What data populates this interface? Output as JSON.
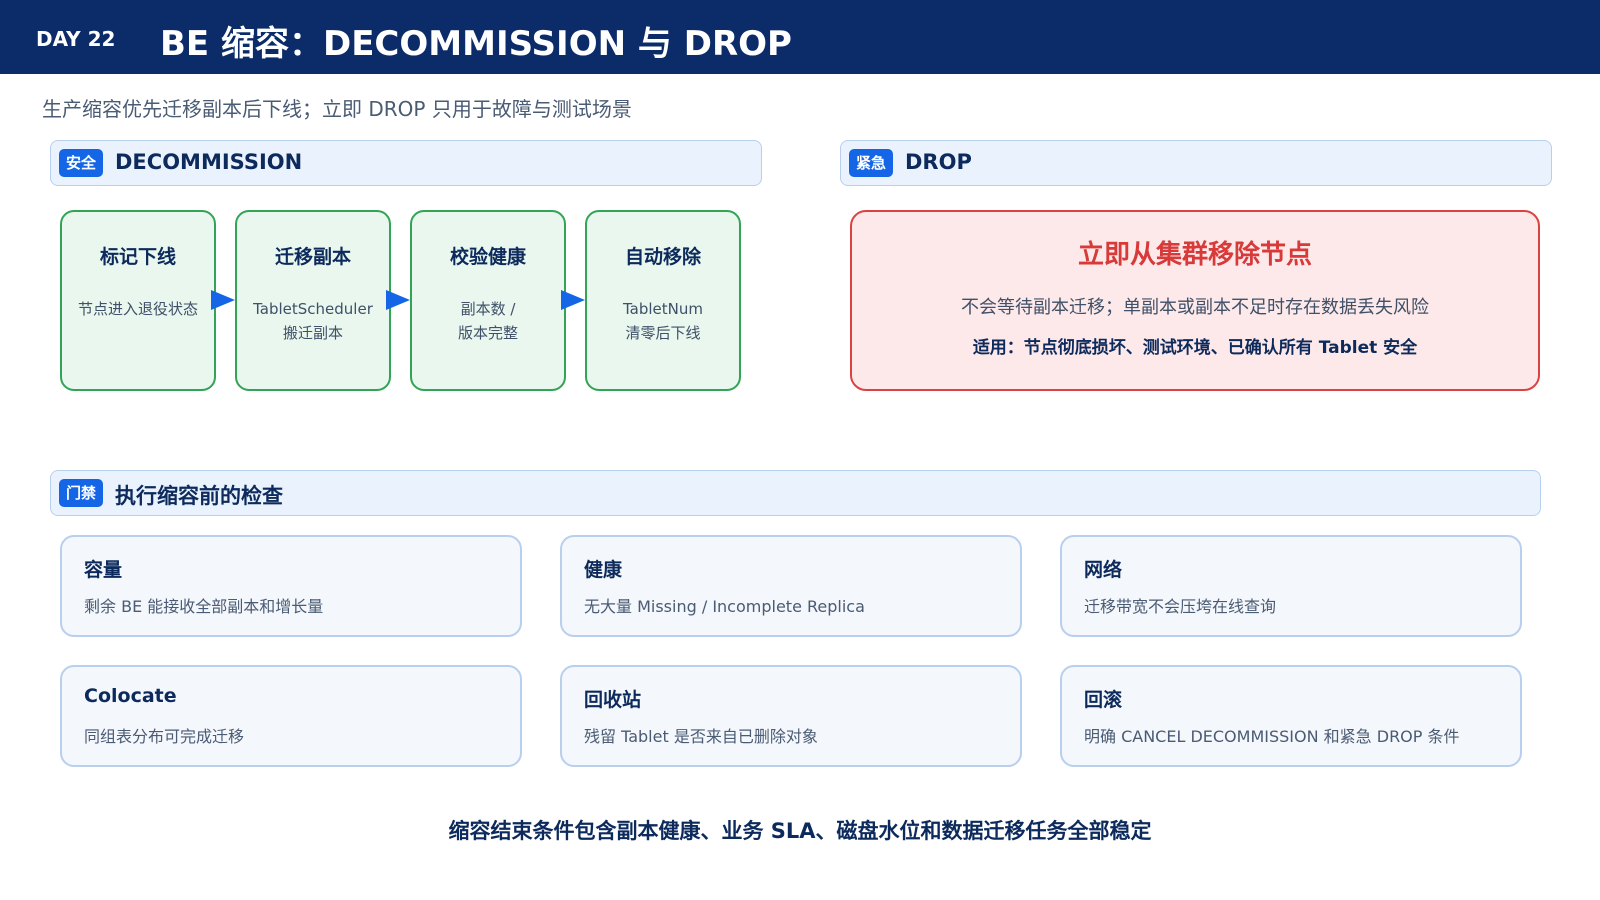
{
  "header": {
    "day": "DAY 22",
    "title": "BE 缩容：DECOMMISSION 与 DROP"
  },
  "subtitle": "生产缩容优先迁移副本后下线；立即 DROP 只用于故障与测试场景",
  "decommission": {
    "tag": "安全",
    "title": "DECOMMISSION",
    "steps": [
      {
        "title": "标记下线",
        "desc": "节点进入退役状态"
      },
      {
        "title": "迁移副本",
        "desc": "TabletScheduler\n搬迁副本"
      },
      {
        "title": "校验健康",
        "desc": "副本数 /\n版本完整"
      },
      {
        "title": "自动移除",
        "desc": "TabletNum\n清零后下线"
      }
    ]
  },
  "drop": {
    "tag": "紧急",
    "title": "DROP",
    "headline": "立即从集群移除节点",
    "description": "不会等待副本迁移；单副本或副本不足时存在数据丢失风险",
    "usage": "适用：节点彻底损坏、测试环境、已确认所有 Tablet 安全"
  },
  "checks": {
    "tag": "门禁",
    "title": "执行缩容前的检查",
    "items": [
      {
        "title": "容量",
        "desc": "剩余 BE 能接收全部副本和增长量"
      },
      {
        "title": "健康",
        "desc": "无大量 Missing / Incomplete Replica"
      },
      {
        "title": "网络",
        "desc": "迁移带宽不会压垮在线查询"
      },
      {
        "title": "Colocate",
        "desc": "同组表分布可完成迁移"
      },
      {
        "title": "回收站",
        "desc": "残留 Tablet 是否来自已删除对象"
      },
      {
        "title": "回滚",
        "desc": "明确 CANCEL DECOMMISSION 和紧急 DROP 条件"
      }
    ]
  },
  "conclusion": "缩容结束条件包含副本健康、业务 SLA、磁盘水位和数据迁移任务全部稳定",
  "colors": {
    "header_bg": "#0b2b69",
    "accent_blue": "#1466e6",
    "success_green": "#33a356",
    "danger_red": "#db4242"
  }
}
